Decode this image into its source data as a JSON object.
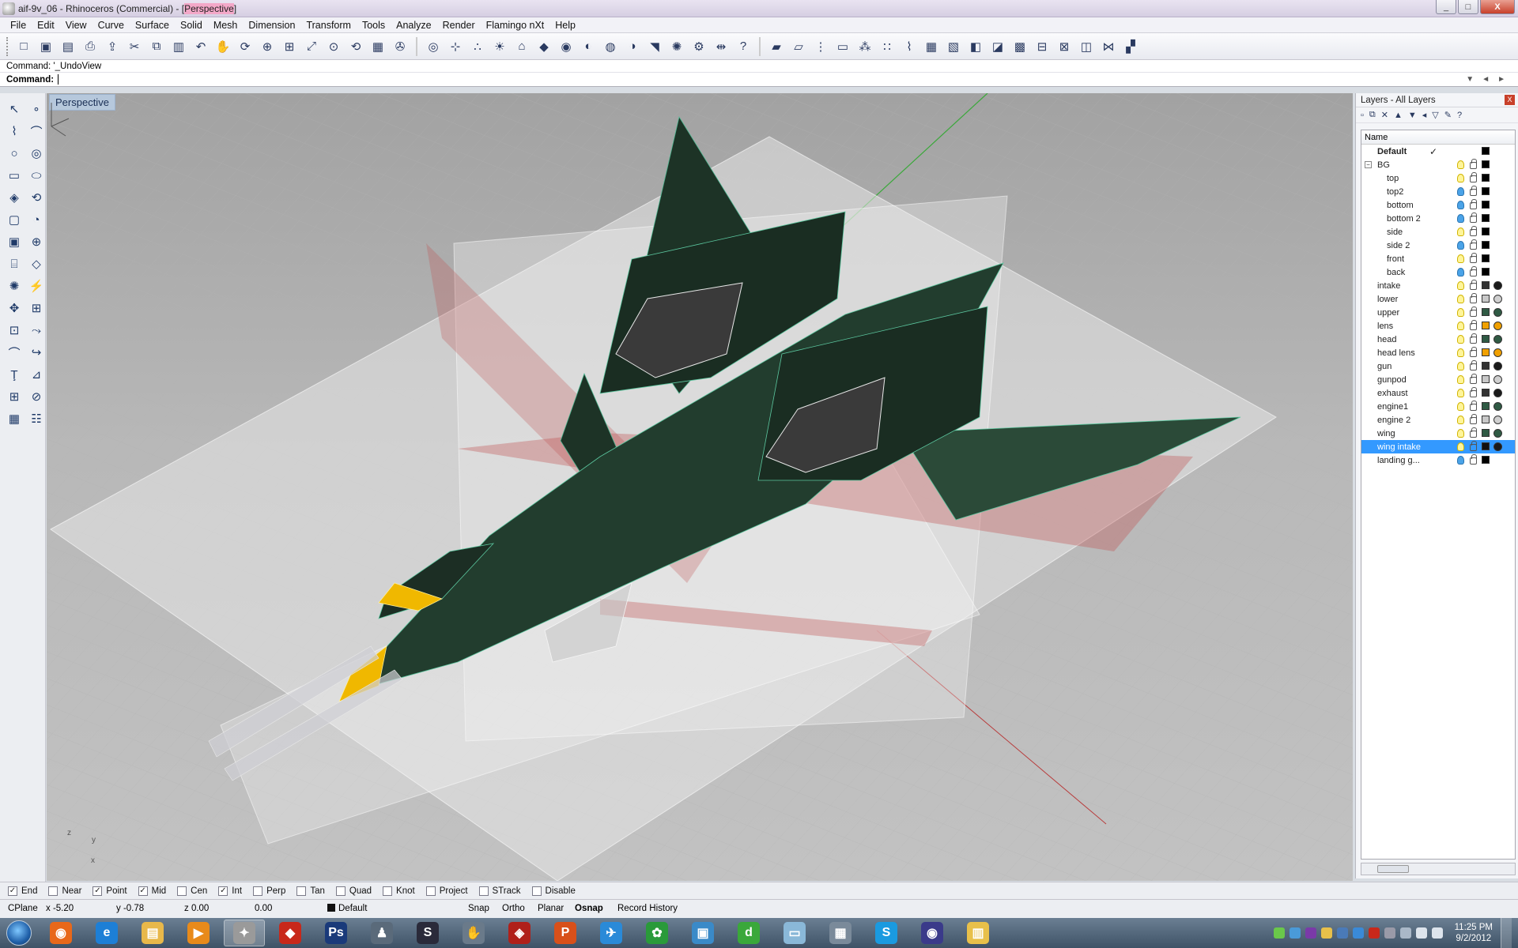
{
  "window": {
    "title_prefix": "aif-9v_06 - Rhinoceros (Commercial) - [",
    "title_view": "Perspective",
    "title_suffix": "]",
    "buttons": [
      "_",
      "□",
      "X"
    ]
  },
  "menu": [
    "File",
    "Edit",
    "View",
    "Curve",
    "Surface",
    "Solid",
    "Mesh",
    "Dimension",
    "Transform",
    "Tools",
    "Analyze",
    "Render",
    "Flamingo nXt",
    "Help"
  ],
  "toolbar_icons": [
    "new-icon",
    "open-icon",
    "save-icon",
    "print-icon",
    "import-icon",
    "cut-icon",
    "copy-icon",
    "paste-icon",
    "undo-icon",
    "pan-icon",
    "rotate-view-icon",
    "zoom-icon",
    "zoom-window-icon",
    "zoom-extents-icon",
    "zoom-selected-icon",
    "rotate-icon",
    "viewport-layout-icon",
    "car-icon",
    "render-preview-icon",
    "cplane-icon",
    "points-icon",
    "light-icon",
    "lock-icon",
    "material-icon",
    "color-wheel-icon",
    "sphere-wire-icon",
    "sphere-shaded-icon",
    "sphere-rendered-icon",
    "flamingo-icon",
    "settings-icon",
    "dimension-icon",
    "help-icon",
    "box-icon",
    "box-edit-icon",
    "grip-icon",
    "window-icon",
    "array-icon",
    "scatter-icon",
    "curve-tools-icon",
    "mesh-grid-icon",
    "edit-image-icon",
    "surface-tool-icon",
    "surface-flow-icon",
    "mesh-icon",
    "layout-icon",
    "measure-icon",
    "network-icon",
    "analysis-icon",
    "trim-icon",
    "render-window-icon"
  ],
  "command": {
    "history": "Command: '_UndoView",
    "prompt": "Command:",
    "value": ""
  },
  "left_tools": [
    "select-icon",
    "point-icon",
    "polyline-icon",
    "curve-icon",
    "circle-icon",
    "arc-icon",
    "rectangle-icon",
    "ellipse-icon",
    "surface-icon",
    "revolve-icon",
    "extrude-icon",
    "loft-icon",
    "box-solid-icon",
    "boolean-icon",
    "cylinder-icon",
    "mesh-plane-icon",
    "gear-icon",
    "explode-icon",
    "move-icon",
    "scale-icon",
    "group-icon",
    "array-curve-icon",
    "fillet-icon",
    "blend-icon",
    "text-icon",
    "dimension-tool-icon",
    "grid-icon",
    "edit-icon",
    "cube-icon",
    "car-wash-icon"
  ],
  "viewport": {
    "label": "Perspective",
    "axis_y": "y",
    "axis_z": "z",
    "axis_x": "x"
  },
  "layers_panel": {
    "title": "Layers - All Layers",
    "close": "X",
    "column_name": "Name",
    "layers": [
      {
        "name": "Default",
        "indent": 0,
        "bold": true,
        "current": true,
        "bulb": "on",
        "color": "#000000",
        "material": ""
      },
      {
        "name": "BG",
        "indent": 0,
        "expander": "−",
        "bulb": "on",
        "color": "#000000",
        "material": ""
      },
      {
        "name": "top",
        "indent": 1,
        "bulb": "on",
        "color": "#000000",
        "material": ""
      },
      {
        "name": "top2",
        "indent": 1,
        "bulb": "off",
        "color": "#000000",
        "material": ""
      },
      {
        "name": "bottom",
        "indent": 1,
        "bulb": "off",
        "color": "#000000",
        "material": ""
      },
      {
        "name": "bottom 2",
        "indent": 1,
        "bulb": "off",
        "color": "#000000",
        "material": ""
      },
      {
        "name": "side",
        "indent": 1,
        "bulb": "on",
        "color": "#000000",
        "material": ""
      },
      {
        "name": "side 2",
        "indent": 1,
        "bulb": "off",
        "color": "#000000",
        "material": ""
      },
      {
        "name": "front",
        "indent": 1,
        "bulb": "on",
        "color": "#000000",
        "material": ""
      },
      {
        "name": "back",
        "indent": 1,
        "bulb": "off",
        "color": "#000000",
        "material": ""
      },
      {
        "name": "intake",
        "indent": 0,
        "bulb": "on",
        "color": "#333333",
        "material": "#1a1a1a"
      },
      {
        "name": "lower",
        "indent": 0,
        "bulb": "on",
        "color": "#c8c8c8",
        "material": "#d0d0d0"
      },
      {
        "name": "upper",
        "indent": 0,
        "bulb": "on",
        "color": "#2f5a44",
        "material": "#2f5a44"
      },
      {
        "name": "lens",
        "indent": 0,
        "bulb": "on",
        "color": "#f0a000",
        "material": "#f0a000"
      },
      {
        "name": "head",
        "indent": 0,
        "bulb": "on",
        "color": "#2f5a44",
        "material": "#2f5a44"
      },
      {
        "name": "head lens",
        "indent": 0,
        "bulb": "on",
        "color": "#f0a000",
        "material": "#f0a000"
      },
      {
        "name": "gun",
        "indent": 0,
        "bulb": "on",
        "color": "#333333",
        "material": "#1a1a1a"
      },
      {
        "name": "gunpod",
        "indent": 0,
        "bulb": "on",
        "color": "#c8c8c8",
        "material": "#d0d0d0"
      },
      {
        "name": "exhaust",
        "indent": 0,
        "bulb": "on",
        "color": "#333333",
        "material": "#1a1a1a"
      },
      {
        "name": "engine1",
        "indent": 0,
        "bulb": "on",
        "color": "#2f5a44",
        "material": "#2f5a44"
      },
      {
        "name": "engine 2",
        "indent": 0,
        "bulb": "on",
        "color": "#c8c8c8",
        "material": "#d0d0d0"
      },
      {
        "name": "wing",
        "indent": 0,
        "bulb": "on",
        "color": "#2f5a44",
        "material": "#2f5a44"
      },
      {
        "name": "wing intake",
        "indent": 0,
        "bulb": "on",
        "selected": true,
        "color": "#111111",
        "material": "#1a1a1a"
      },
      {
        "name": "landing g...",
        "indent": 0,
        "bulb": "off",
        "color": "#000000",
        "material": ""
      }
    ]
  },
  "osnap": [
    {
      "label": "End",
      "checked": true
    },
    {
      "label": "Near",
      "checked": false
    },
    {
      "label": "Point",
      "checked": true
    },
    {
      "label": "Mid",
      "checked": true
    },
    {
      "label": "Cen",
      "checked": false
    },
    {
      "label": "Int",
      "checked": true
    },
    {
      "label": "Perp",
      "checked": false
    },
    {
      "label": "Tan",
      "checked": false
    },
    {
      "label": "Quad",
      "checked": false
    },
    {
      "label": "Knot",
      "checked": false
    },
    {
      "label": "Project",
      "checked": false
    },
    {
      "label": "STrack",
      "checked": false
    },
    {
      "label": "Disable",
      "checked": false
    }
  ],
  "status": {
    "cplane": "CPlane",
    "x": "x -5.20",
    "y": "y -0.78",
    "z": "z 0.00",
    "d": "0.00",
    "layer": "Default",
    "snap": "Snap",
    "ortho": "Ortho",
    "planar": "Planar",
    "osnap": "Osnap",
    "record": "Record History"
  },
  "taskbar": {
    "apps": [
      {
        "icon": "firefox-icon",
        "color": "#e8681a",
        "glyph": "◉"
      },
      {
        "icon": "ie-icon",
        "color": "#1d7fd6",
        "glyph": "e"
      },
      {
        "icon": "folder-icon",
        "color": "#e8b84a",
        "glyph": "▤"
      },
      {
        "icon": "media-player-icon",
        "color": "#e88a1a",
        "glyph": "▶"
      },
      {
        "icon": "rhino-icon",
        "color": "#9a9a9a",
        "glyph": "✦",
        "active": true
      },
      {
        "icon": "sketchup-icon",
        "color": "#c8281a",
        "glyph": "◆"
      },
      {
        "icon": "photoshop-icon",
        "color": "#1a3a7a",
        "glyph": "Ps"
      },
      {
        "icon": "poser-icon",
        "color": "#5a6a7a",
        "glyph": "♟"
      },
      {
        "icon": "steam-icon",
        "color": "#2a2a3a",
        "glyph": "S"
      },
      {
        "icon": "hand-icon",
        "color": "#6a7a8a",
        "glyph": "✋"
      },
      {
        "icon": "red-app-icon",
        "color": "#b0201a",
        "glyph": "◈"
      },
      {
        "icon": "powerpoint-icon",
        "color": "#d8501a",
        "glyph": "P"
      },
      {
        "icon": "bird-icon",
        "color": "#2a8ad8",
        "glyph": "✈"
      },
      {
        "icon": "leaf-icon",
        "color": "#2a9a3a",
        "glyph": "✿"
      },
      {
        "icon": "cubes-icon",
        "color": "#3a8ac8",
        "glyph": "▣"
      },
      {
        "icon": "dreamweaver-icon",
        "color": "#3aa83a",
        "glyph": "d"
      },
      {
        "icon": "tablet-icon",
        "color": "#8ab8d8",
        "glyph": "▭"
      },
      {
        "icon": "calculator-icon",
        "color": "#7a8a9a",
        "glyph": "▦"
      },
      {
        "icon": "skype-icon",
        "color": "#1a9ae0",
        "glyph": "S"
      },
      {
        "icon": "eye-icon",
        "color": "#3a3a8a",
        "glyph": "◉"
      },
      {
        "icon": "notes-icon",
        "color": "#e8c04a",
        "glyph": "▥"
      }
    ],
    "time": "11:25 PM",
    "date": "9/2/2012"
  }
}
